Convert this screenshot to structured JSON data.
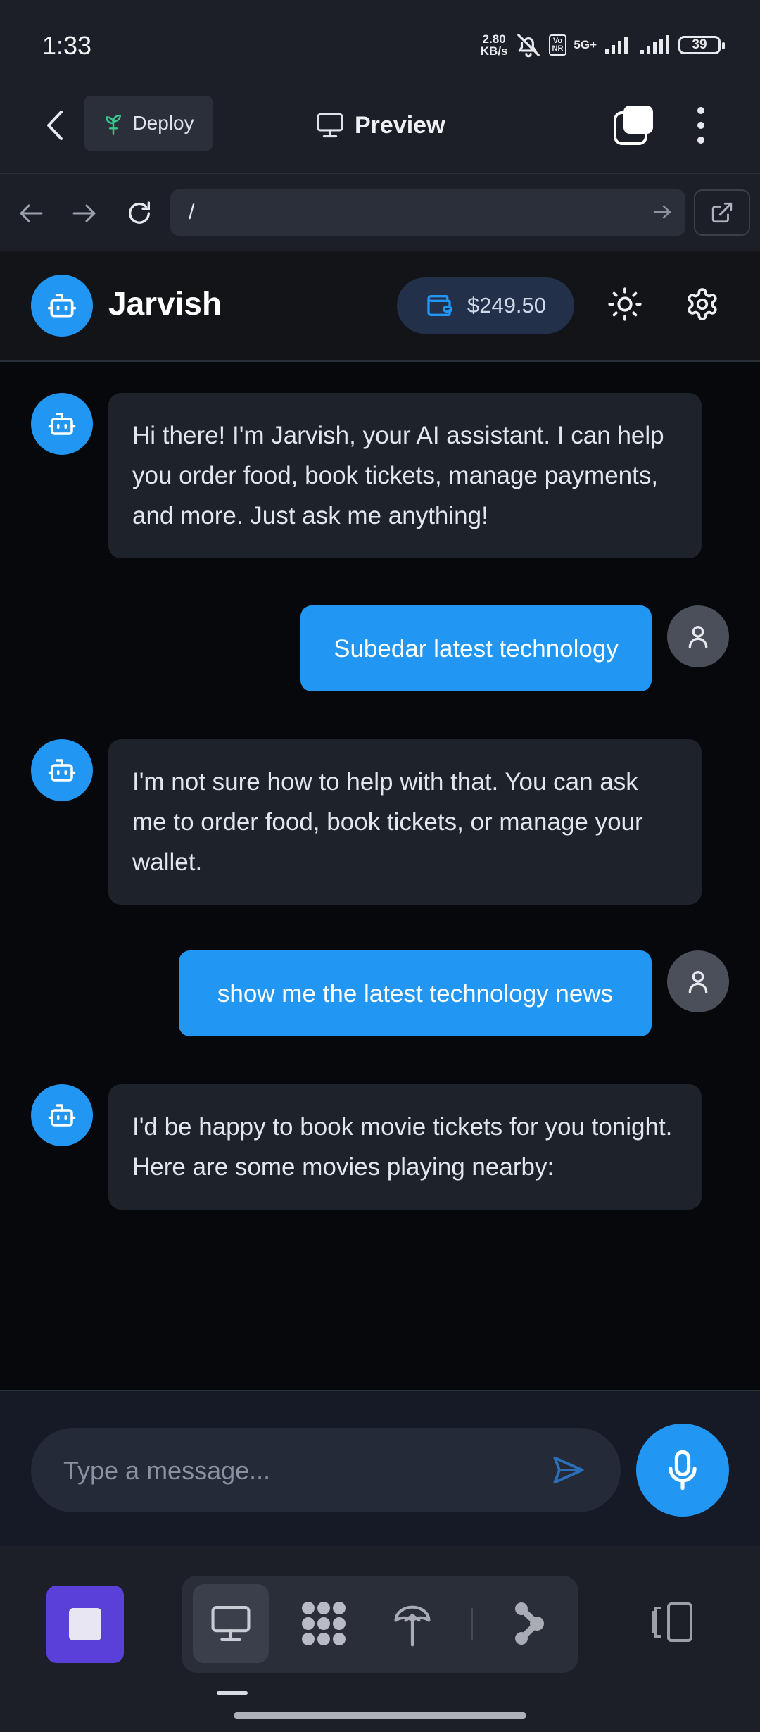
{
  "status_bar": {
    "time": "1:33",
    "speed_top": "2.80",
    "speed_bottom": "KB/s",
    "vo_top": "Vo",
    "vo_bottom": "NR",
    "network": "5G+",
    "battery": "39"
  },
  "toolbar": {
    "deploy_label": "Deploy",
    "preview_label": "Preview"
  },
  "browser": {
    "url": "/"
  },
  "app": {
    "title": "Jarvish",
    "wallet_balance": "$249.50"
  },
  "messages": [
    {
      "role": "bot",
      "text": "Hi there! I'm Jarvish, your AI assistant. I can help you order food, book tickets, manage payments, and more. Just ask me anything!"
    },
    {
      "role": "user",
      "text": "Subedar latest technology"
    },
    {
      "role": "bot",
      "text": "I'm not sure how to help with that. You can ask me to order food, book tickets, or manage your wallet."
    },
    {
      "role": "user",
      "text": "show me the latest technology news"
    },
    {
      "role": "bot",
      "text": "I'd be happy to book movie tickets for you tonight. Here are some movies playing nearby:"
    }
  ],
  "input": {
    "placeholder": "Type a message...",
    "value": ""
  },
  "colors": {
    "accent": "#2196f3",
    "stop": "#5a3fd8",
    "background": "#07080b",
    "bubble_bot": "#1e222b"
  },
  "icons": [
    "back-arrow-icon",
    "sprout-icon",
    "monitor-icon",
    "tabs-icon",
    "more-vertical-icon",
    "arrow-left-icon",
    "arrow-right-icon",
    "reload-icon",
    "external-link-icon",
    "robot-icon",
    "wallet-icon",
    "sun-icon",
    "gear-icon",
    "user-icon",
    "send-icon",
    "mic-icon",
    "apps-icon",
    "antenna-icon",
    "share-icon",
    "phone-rotate-icon"
  ]
}
